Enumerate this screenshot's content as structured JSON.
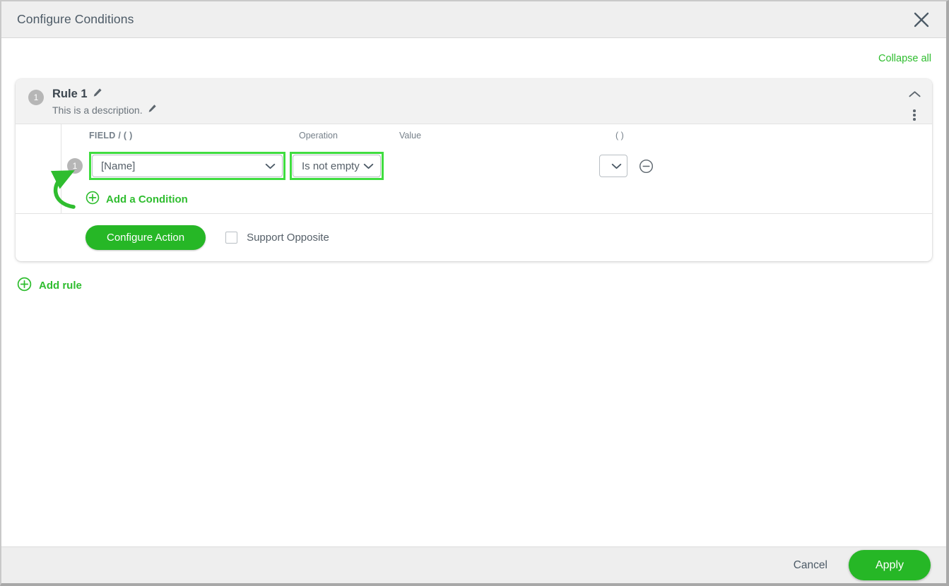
{
  "window": {
    "title": "Configure Conditions",
    "close_icon": "close-icon"
  },
  "toolbar": {
    "collapse_all_label": "Collapse all"
  },
  "rule": {
    "number": "1",
    "title": "Rule 1",
    "description": "This is a description.",
    "edit_title_icon": "pencil-icon",
    "edit_description_icon": "pencil-icon",
    "collapse_icon": "chevron-up-icon",
    "menu_icon": "kebab-menu-icon"
  },
  "columns": {
    "field": "FIELD / ( )",
    "operation": "Operation",
    "value": "Value",
    "parenthesis": "( )"
  },
  "condition": {
    "number": "1",
    "field_value": "[Name]",
    "operation_value": "Is not empty",
    "value_value": "",
    "close_paren_value": "",
    "dropdown_icon": "chevron-down-icon",
    "remove_icon": "circle-minus-icon"
  },
  "links": {
    "add_condition_label": "Add a Condition",
    "add_condition_icon": "circle-plus-icon",
    "add_rule_label": "Add rule",
    "add_rule_icon": "circle-plus-icon"
  },
  "actions": {
    "configure_action_label": "Configure Action",
    "support_opposite_label": "Support Opposite",
    "support_opposite_checked": false
  },
  "footer": {
    "cancel_label": "Cancel",
    "apply_label": "Apply"
  },
  "colors": {
    "green_accent": "#2fbd2f",
    "green_button": "#26b726",
    "highlight_green": "#3fdd3f",
    "title_text": "#4c5a66",
    "header_bg": "#efefef",
    "card_header_bg": "#f2f2f2",
    "footer_bg": "#eeeeee"
  },
  "annotations": {
    "highlight_field_dropdown": true,
    "highlight_operation_dropdown": true,
    "arrow_from": "add-a-condition",
    "arrow_to": "condition-row-number-1"
  }
}
